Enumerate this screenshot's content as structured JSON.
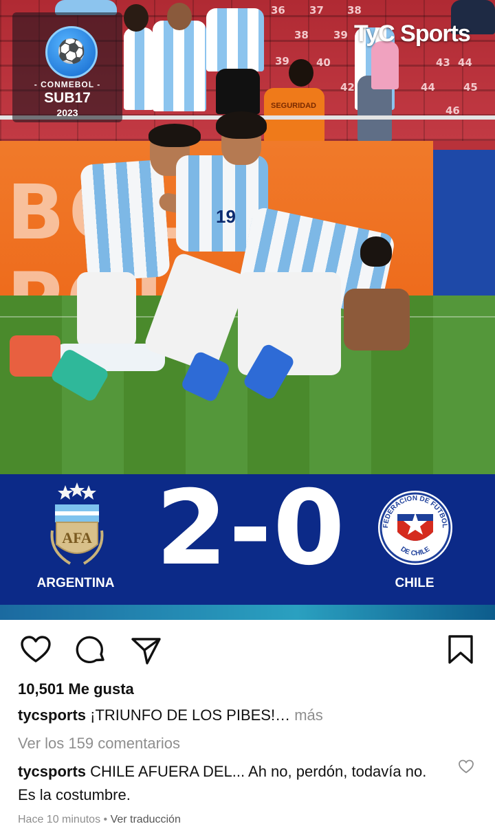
{
  "photo": {
    "tournament_logo": {
      "line1": "- CONMEBOL -",
      "line2": "SUB17",
      "line3": "2023",
      "icon": "soccer-player-icon"
    },
    "broadcaster": "TyC Sports",
    "stand_numbers": [
      "36",
      "37",
      "38",
      "38",
      "39",
      "39",
      "40",
      "42",
      "43",
      "44",
      "44",
      "45",
      "46"
    ],
    "ad_board_text": "BOL  Á  POL",
    "vest_text": "SEGURIDAD",
    "jersey_number": "19"
  },
  "scoreboard": {
    "home_team": "ARGENTINA",
    "away_team": "CHILE",
    "score": "2-0",
    "home_crest_text": "AFA",
    "away_crest_text_top": "FEDERACION DE FUTBOL",
    "away_crest_text_bottom": "DE CHILE",
    "colors": {
      "banner": "#0c2a88",
      "strip": "#2aa0c0"
    }
  },
  "post": {
    "actions": [
      "heart-icon",
      "comment-icon",
      "share-icon",
      "bookmark-icon"
    ],
    "likes": "10,501 Me gusta",
    "caption_user": "tycsports",
    "caption_text": " ¡TRIUNFO DE LOS PIBES!…",
    "caption_more": " más",
    "view_comments": "Ver los 159 comentarios",
    "comment_user": "tycsports",
    "comment_text": " CHILE AFUERA DEL... Ah no, perdón, todavía no. Es la costumbre.",
    "time_ago": "Hace 10 minutos",
    "separator": " • ",
    "translate": "Ver traducción"
  }
}
